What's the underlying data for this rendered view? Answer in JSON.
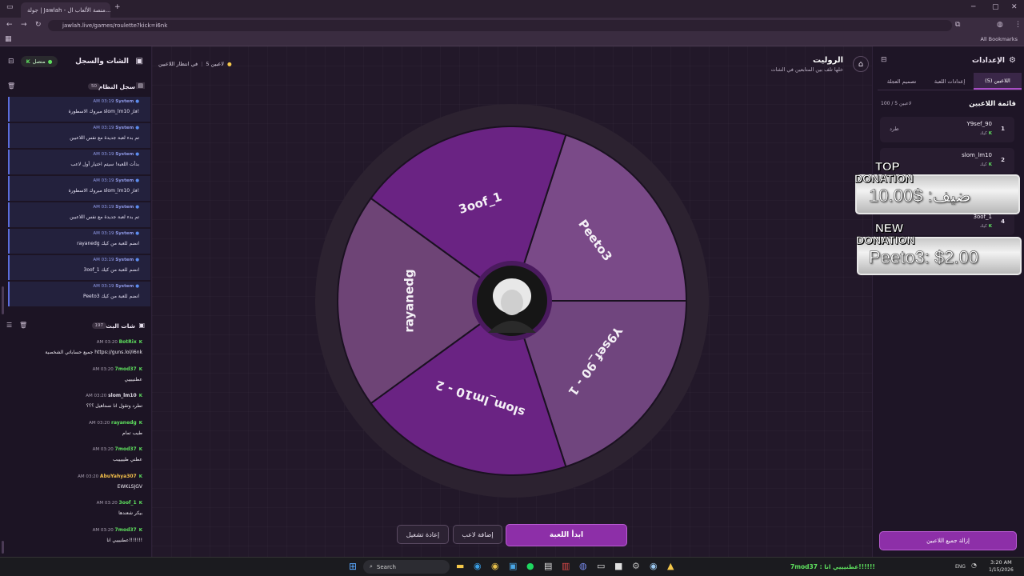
{
  "browser": {
    "tab_title": "جولة | Jawlah - منصة الألعاب ال...",
    "url": "jawlah.live/games/roulette?kick=i6nk",
    "bookmarks": "All Bookmarks"
  },
  "left_panel": {
    "title": "الشات والسجل",
    "status": "متصل",
    "syslog_title": "سجل النظام",
    "syslog_count": "50",
    "syslog": [
      {
        "user": "System",
        "time": "AM 03:19",
        "msg": "مبروك الاسطورة slom_lm10 فاز!"
      },
      {
        "user": "System",
        "time": "AM 03:19",
        "msg": "تم بدء لعبة جديدة مع نفس اللاعبين"
      },
      {
        "user": "System",
        "time": "AM 03:19",
        "msg": "بدأت اللعبة! سيتم اختيار أول لاعب"
      },
      {
        "user": "System",
        "time": "AM 03:19",
        "msg": "مبروك الاسطورة slom_lm10 فاز!"
      },
      {
        "user": "System",
        "time": "AM 03:19",
        "msg": "تم بدء لعبة جديدة مع نفس اللاعبين"
      },
      {
        "user": "System",
        "time": "AM 03:19",
        "msg": "rayanedg انضم للعبة من كيك"
      },
      {
        "user": "System",
        "time": "AM 03:19",
        "msg": "3oof_1 انضم للعبة من كيك"
      },
      {
        "user": "System",
        "time": "AM 03:19",
        "msg": "Peeto3 انضم للعبة من كيك"
      }
    ],
    "chat_title": "شات البث",
    "chat_count": "197",
    "chat": [
      {
        "user": "BotRix",
        "color": "#5ee05e",
        "time": "AM 03:20",
        "msg": "جميع حساباتي الشخصية https://guns.lol/i6nk"
      },
      {
        "user": "7mod37",
        "color": "#5ee05e",
        "time": "AM 03:20",
        "msg": "عطنييييي"
      },
      {
        "user": "slom_lm10",
        "color": "#e0dce6",
        "time": "AM 03:20",
        "msg": "تطرد وتقول انا نستاهيل ؟؟؟"
      },
      {
        "user": "rayanedg",
        "color": "#5ee05e",
        "time": "AM 03:20",
        "msg": "طيب تمام"
      },
      {
        "user": "7mod37",
        "color": "#5ee05e",
        "time": "AM 03:20",
        "msg": "عطني طيييييب"
      },
      {
        "user": "AbuYahya307",
        "color": "#f5c04a",
        "time": "AM 03:20",
        "msg": "EWKLSJGV"
      },
      {
        "user": "3oof_1",
        "color": "#5ee05e",
        "time": "AM 03:20",
        "msg": "بيكر شعندها"
      },
      {
        "user": "7mod37",
        "color": "#5ee05e",
        "time": "AM 03:20",
        "msg": "عطنيييي انا!!!!!!!"
      }
    ]
  },
  "center": {
    "title": "الروليت",
    "subtitle": "خلها تلف بين المتابعين في الشات",
    "status_players": "5 لاعبين",
    "status_waiting": "في انتظار اللاعبين",
    "wheel_segments": [
      {
        "label": "Peeto3",
        "color": "#7a4a88"
      },
      {
        "label": "Y9sef_90 - 1",
        "color": "#70457e"
      },
      {
        "label": "slom_lm10 - 2",
        "color": "#6a2383"
      },
      {
        "label": "rayanedg",
        "color": "#6e4476"
      },
      {
        "label": "3oof_1",
        "color": "#6a2383"
      }
    ],
    "start_button": "ابدأ اللعبة",
    "add_player_button": "إضافة لاعب",
    "restart_button": "إعادة تشغيل"
  },
  "right_panel": {
    "title": "الإعدادات",
    "tabs": [
      "اللاعبين (5)",
      "إعدادات اللعبة",
      "تصميم العجلة"
    ],
    "list_title": "قائمة اللاعبين",
    "list_count": "100 / 5 لاعبين",
    "players": [
      {
        "num": "1",
        "name": "Y9sef_90",
        "tag": "كيك",
        "action": "طرد"
      },
      {
        "num": "2",
        "name": "slom_lm10",
        "tag": "كيك",
        "action": ""
      },
      {
        "num": "3",
        "name": "rayanedg",
        "tag": "كيك",
        "action": ""
      },
      {
        "num": "4",
        "name": "3oof_1",
        "tag": "كيك",
        "action": ""
      },
      {
        "num": "5",
        "name": "Peeto3",
        "tag": "كيك",
        "action": ""
      }
    ],
    "remove_all_button": "إزالة جميع اللاعبين"
  },
  "overlay": {
    "top_label": "TOP",
    "top_sub": "DONATION",
    "top_value": "ضيف: $10.00",
    "new_label": "NEW",
    "new_sub": "DONATION",
    "new_value": "Peeto3: $2.00"
  },
  "taskbar": {
    "search": "Search",
    "ticker": "7mod37 : عطنيييي انا!!!!!!",
    "lang": "ENG",
    "time": "3:20 AM",
    "date": "1/15/2026"
  }
}
